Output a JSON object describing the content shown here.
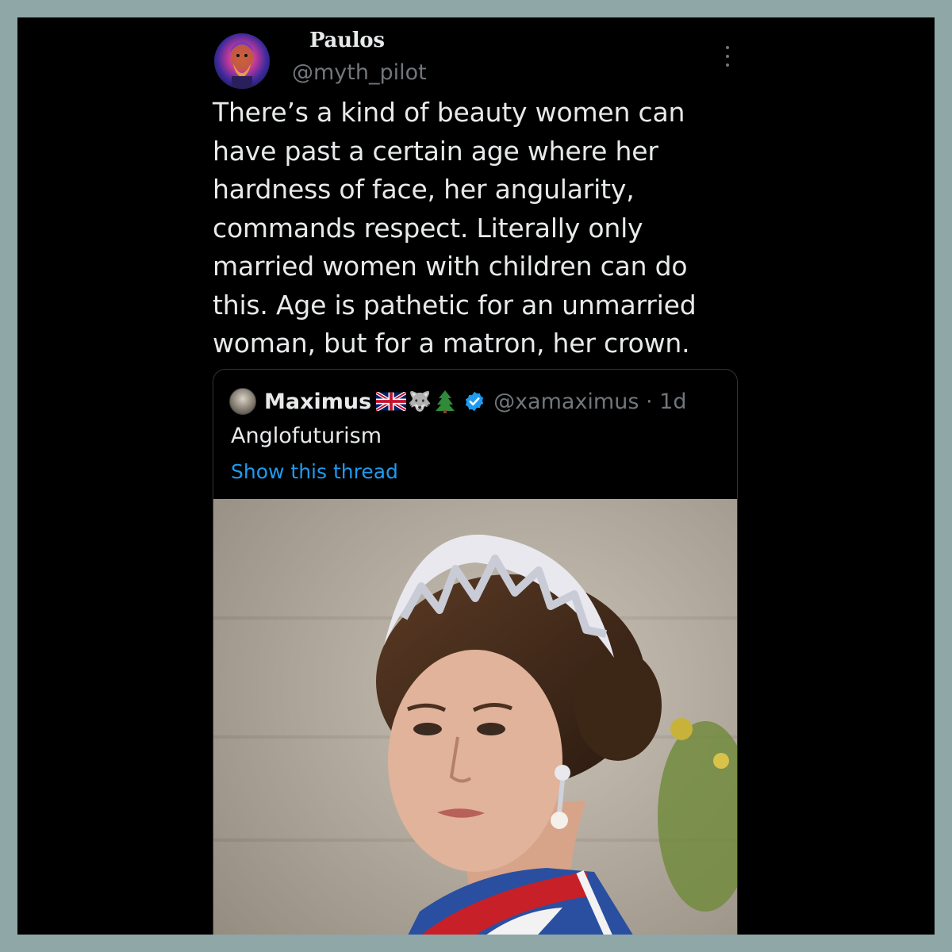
{
  "tweet": {
    "author": {
      "display_name": "Paulos",
      "handle": "@myth_pilot",
      "avatar_icon": "classical-bust-avatar"
    },
    "text": "There’s a kind of beauty women can\nhave past a certain age where her\nhardness of face, her angularity,\ncommands respect. Literally only\nmarried women with children can do\nthis. Age is pathetic for an unmarried\nwoman, but for a matron, her crown.",
    "more_icon": "more-vertical-icon"
  },
  "quoted_tweet": {
    "display_name": "Maximus",
    "emoji": [
      "uk-flag-icon",
      "wolf-icon",
      "evergreen-tree-icon"
    ],
    "verified_icon": "verified-badge-icon",
    "handle_time": "@xamaximus · 1d",
    "text": "Anglofuturism",
    "show_thread_label": "Show this thread",
    "media_description_icon": "photo-woman-with-tiara"
  },
  "colors": {
    "background": "#000000",
    "frame": "#8fa7a6",
    "text_primary": "#e7e9ea",
    "text_secondary": "#71767b",
    "link": "#1d9bf0",
    "verified": "#1d9bf0"
  }
}
